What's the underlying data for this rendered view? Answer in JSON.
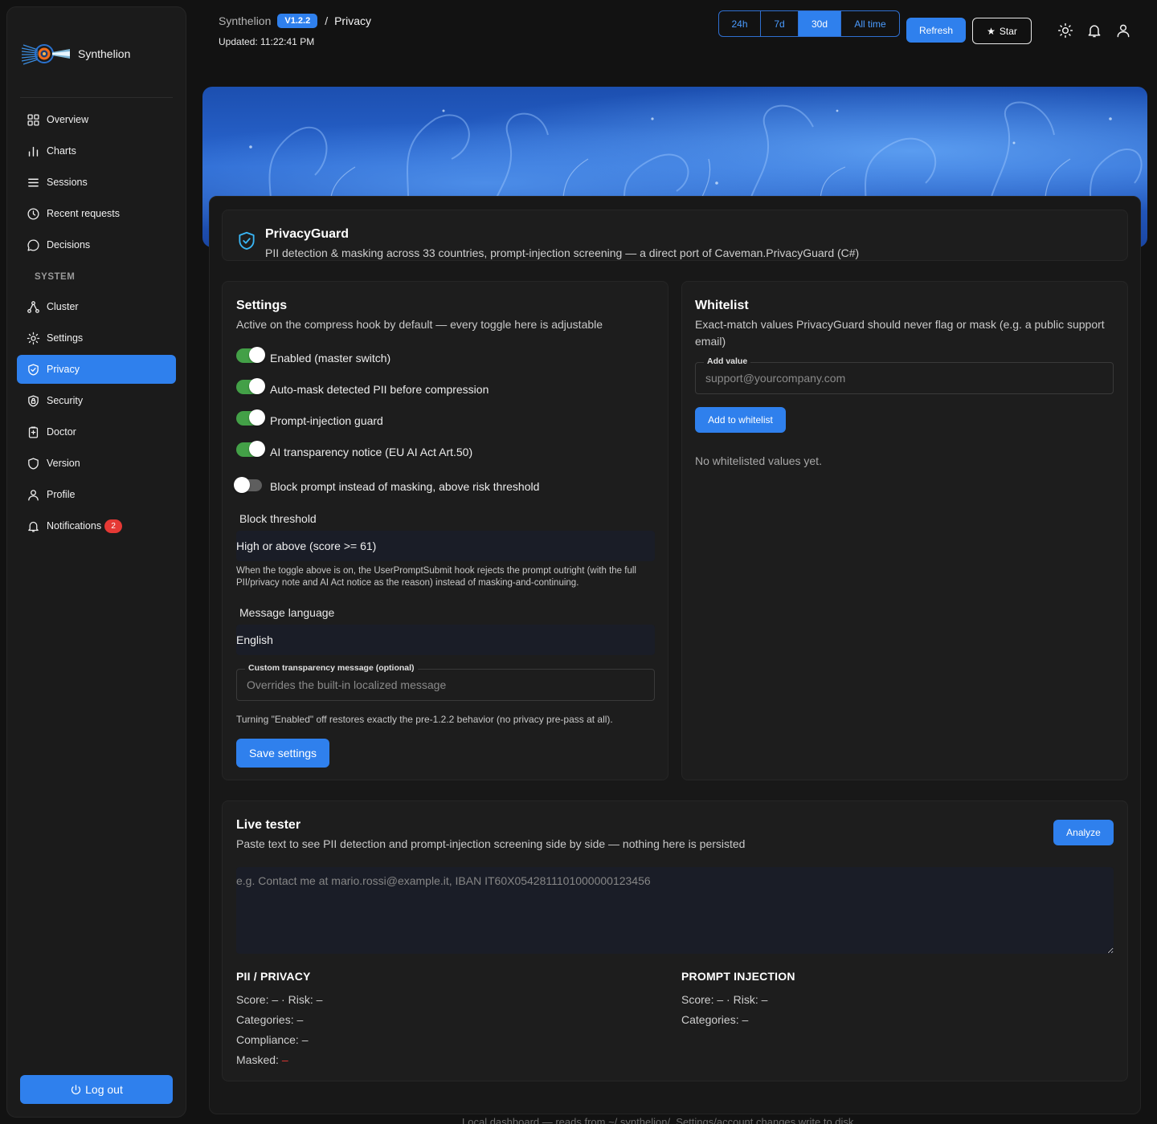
{
  "brand": {
    "name": "Synthelion"
  },
  "sidebar": {
    "items": [
      {
        "label": "Overview",
        "icon": "grid-icon"
      },
      {
        "label": "Charts",
        "icon": "bar-chart-icon"
      },
      {
        "label": "Sessions",
        "icon": "list-icon"
      },
      {
        "label": "Recent requests",
        "icon": "clock-icon"
      },
      {
        "label": "Decisions",
        "icon": "chat-bubble-icon"
      }
    ],
    "section_label": "SYSTEM",
    "system_items": [
      {
        "label": "Cluster",
        "icon": "nodes-icon"
      },
      {
        "label": "Settings",
        "icon": "gear-icon"
      },
      {
        "label": "Privacy",
        "icon": "shield-check-icon",
        "active": true
      },
      {
        "label": "Security",
        "icon": "shield-lock-icon"
      },
      {
        "label": "Doctor",
        "icon": "clipboard-icon"
      },
      {
        "label": "Version",
        "icon": "shield-icon"
      },
      {
        "label": "Profile",
        "icon": "user-icon"
      },
      {
        "label": "Notifications",
        "icon": "bell-icon",
        "badge": "2"
      }
    ],
    "logout_label": "Log out"
  },
  "header": {
    "app": "Synthelion",
    "version": "V1.2.2",
    "separator": "/",
    "page": "Privacy",
    "updated": "Updated: 11:22:41 PM",
    "ranges": [
      "24h",
      "7d",
      "30d",
      "All time"
    ],
    "active_range": "30d",
    "refresh_label": "Refresh",
    "star_label": "Star"
  },
  "privacy_guard": {
    "title": "PrivacyGuard",
    "description": "PII detection & masking across 33 countries, prompt-injection screening — a direct port of Caveman.PrivacyGuard (C#)"
  },
  "settings": {
    "title": "Settings",
    "subtitle": "Active on the compress hook by default — every toggle here is adjustable",
    "toggles": [
      {
        "label": "Enabled (master switch)",
        "on": true
      },
      {
        "label": "Auto-mask detected PII before compression",
        "on": true
      },
      {
        "label": "Prompt-injection guard",
        "on": true
      },
      {
        "label": "AI transparency notice (EU AI Act Art.50)",
        "on": true
      },
      {
        "label": "Block prompt instead of masking, above risk threshold",
        "on": false
      }
    ],
    "block_threshold_label": "Block threshold",
    "block_threshold_value": "High or above (score >= 61)",
    "block_help": "When the toggle above is on, the UserPromptSubmit hook rejects the prompt outright (with the full PII/privacy note and AI Act notice as the reason) instead of masking-and-continuing.",
    "language_label": "Message language",
    "language_value": "English",
    "custom_message_label": "Custom transparency message (optional)",
    "custom_message_placeholder": "Overrides the built-in localized message",
    "note": "Turning \"Enabled\" off restores exactly the pre-1.2.2 behavior (no privacy pre-pass at all).",
    "save_label": "Save settings"
  },
  "whitelist": {
    "title": "Whitelist",
    "subtitle": "Exact-match values PrivacyGuard should never flag or mask (e.g. a public support email)",
    "add_label": "Add value",
    "add_placeholder": "support@yourcompany.com",
    "add_button": "Add to whitelist",
    "empty": "No whitelisted values yet."
  },
  "tester": {
    "title": "Live tester",
    "subtitle": "Paste text to see PII detection and prompt-injection screening side by side — nothing here is persisted",
    "analyze_label": "Analyze",
    "placeholder": "e.g. Contact me at mario.rossi@example.it, IBAN IT60X0542811101000000123456",
    "pii": {
      "heading": "PII / PRIVACY",
      "score_label": "Score:",
      "score": "–",
      "dot": "·",
      "risk_label": "Risk:",
      "risk": "–",
      "categories_label": "Categories:",
      "categories": "–",
      "compliance_label": "Compliance:",
      "compliance": "–",
      "masked_label": "Masked:",
      "masked": "–"
    },
    "injection": {
      "heading": "PROMPT INJECTION",
      "score_label": "Score:",
      "score": "–",
      "dot": "·",
      "risk_label": "Risk:",
      "risk": "–",
      "categories_label": "Categories:",
      "categories": "–"
    }
  },
  "footer": {
    "text": "Local dashboard — reads from ~/.synthelion/. Settings/account changes write to disk."
  }
}
